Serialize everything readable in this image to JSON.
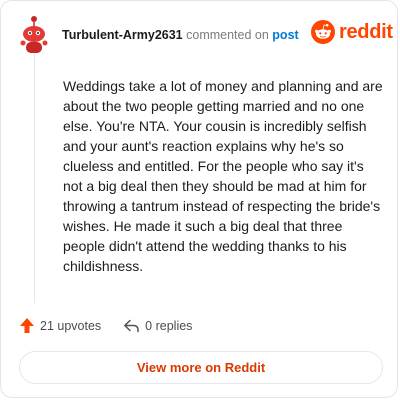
{
  "header": {
    "username": "Turbulent-Army2631",
    "commented_text": "commented on",
    "post_link": "post"
  },
  "brand": {
    "name": "reddit",
    "color": "#ff4500",
    "icon": "reddit-snoo-icon"
  },
  "comment": {
    "body": "Weddings take a lot of money and planning and are about the two people getting married and no one else. You're NTA. Your cousin is incredibly selfish and your aunt's reaction explains why he's so clueless and entitled. For the people who say it's not a big deal then they should be mad at him for throwing a tantrum instead of respecting the bride's wishes. He made it such a big deal that three people didn't attend the wedding thanks to his childishness."
  },
  "footer": {
    "upvotes": "21 upvotes",
    "replies": "0 replies",
    "upvote_icon": "upvote-arrow-icon",
    "reply_icon": "reply-arrow-icon"
  },
  "cta": {
    "label": "View more on Reddit",
    "color": "#d93a00"
  }
}
